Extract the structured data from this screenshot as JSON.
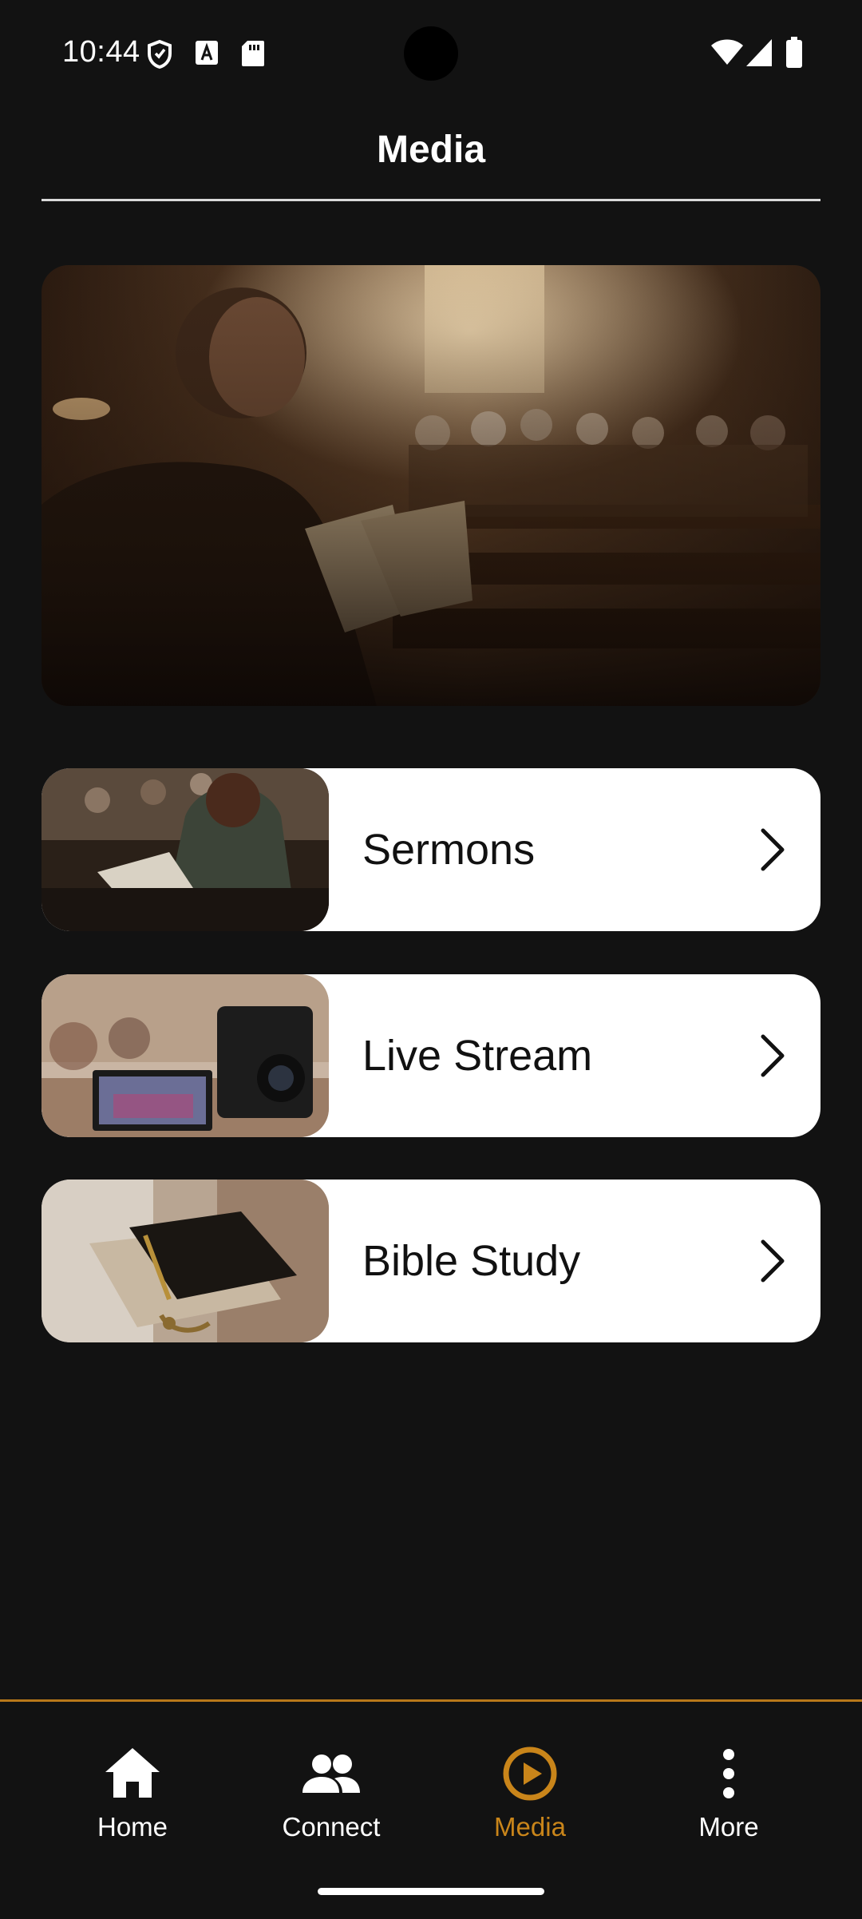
{
  "status_bar": {
    "time": "10:44"
  },
  "header": {
    "title": "Media"
  },
  "cards": [
    {
      "label": "Sermons"
    },
    {
      "label": "Live Stream"
    },
    {
      "label": "Bible Study"
    }
  ],
  "bottom_nav": {
    "items": [
      {
        "label": "Home",
        "icon": "home-icon"
      },
      {
        "label": "Connect",
        "icon": "people-icon"
      },
      {
        "label": "Media",
        "icon": "play-circle-icon",
        "active": true
      },
      {
        "label": "More",
        "icon": "more-vertical-icon"
      }
    ]
  },
  "colors": {
    "background": "#121212",
    "accent": "#c9851a",
    "card": "#ffffff"
  }
}
